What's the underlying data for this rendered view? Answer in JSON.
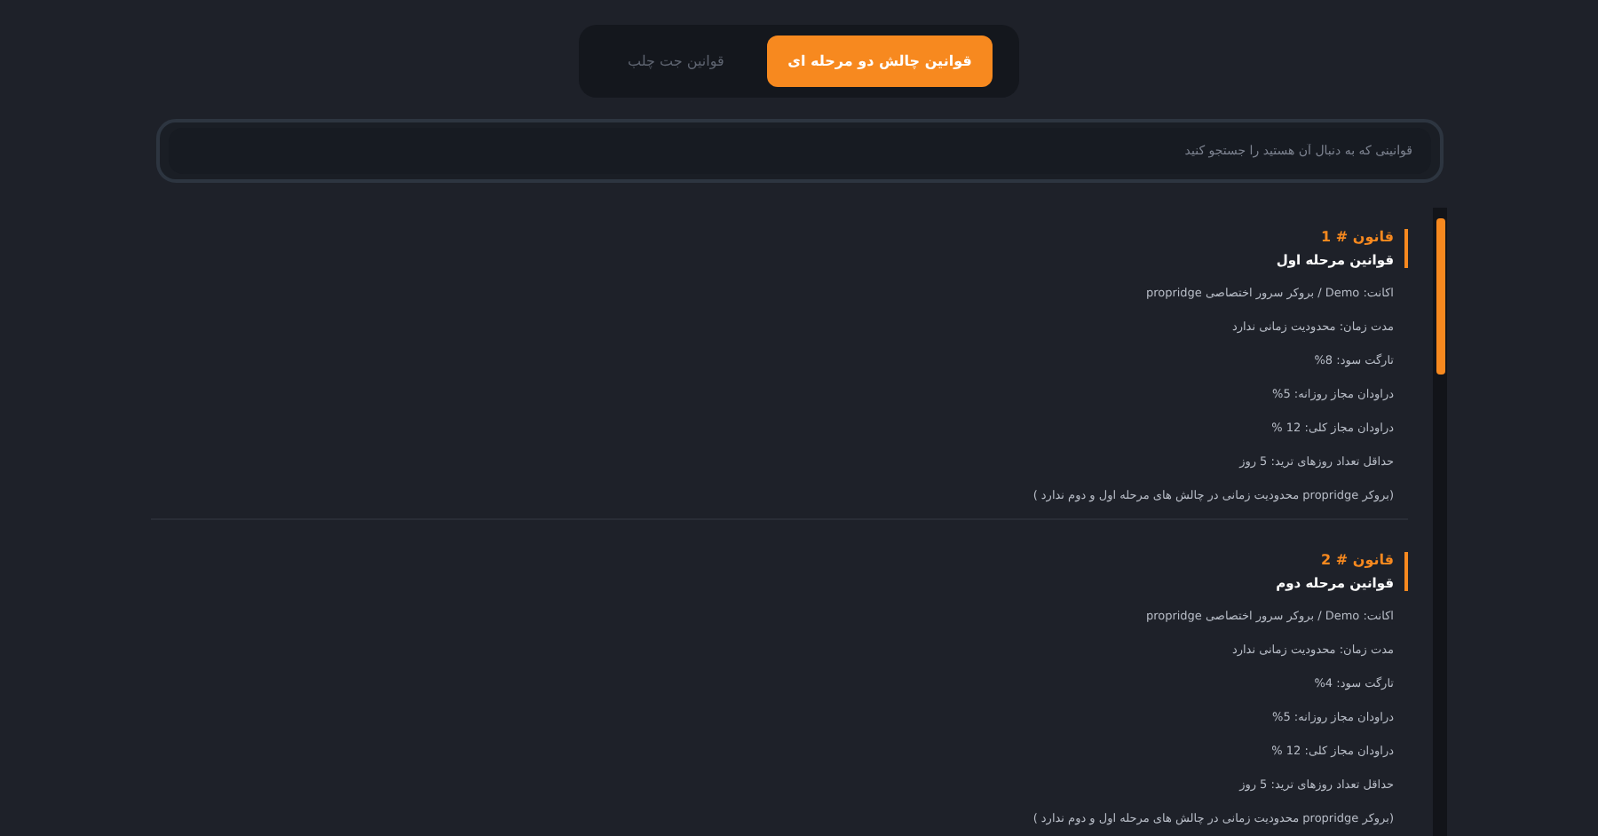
{
  "tabs": [
    {
      "label": "قوانین چالش دو مرحله ای",
      "selected": true
    },
    {
      "label": "قوانین جت چلب",
      "selected": false
    }
  ],
  "search": {
    "placeholder": "قوانینی که به دنبال آن هستید را جستجو کنید"
  },
  "rules": [
    {
      "title": "قانون # 1",
      "subtitle": "قوانین مرحله اول",
      "lines": [
        "اکانت: Demo / بروکر سرور اختصاصی propridge",
        "مدت زمان: محدودیت زمانی ندارد",
        "تارگت سود: 8%",
        "دراودان مجاز روزانه: 5%",
        "دراودان مجاز کلی: 12 %",
        "حداقل تعداد روزهای ترید: 5 روز",
        "(بروکر propridge محدودیت زمانی در چالش های مرحله اول و دوم ندارد )"
      ]
    },
    {
      "title": "قانون # 2",
      "subtitle": "قوانین مرحله دوم",
      "lines": [
        "اکانت: Demo / بروکر سرور اختصاصی propridge",
        "مدت زمان: محدودیت زمانی ندارد",
        "تارگت سود: 4%",
        "دراودان مجاز روزانه: 5%",
        "دراودان مجاز کلی: 12 %",
        "حداقل تعداد روزهای ترید: 5 روز",
        "(بروکر propridge محدودیت زمانی در چالش های مرحله اول و دوم ندارد )"
      ]
    }
  ]
}
